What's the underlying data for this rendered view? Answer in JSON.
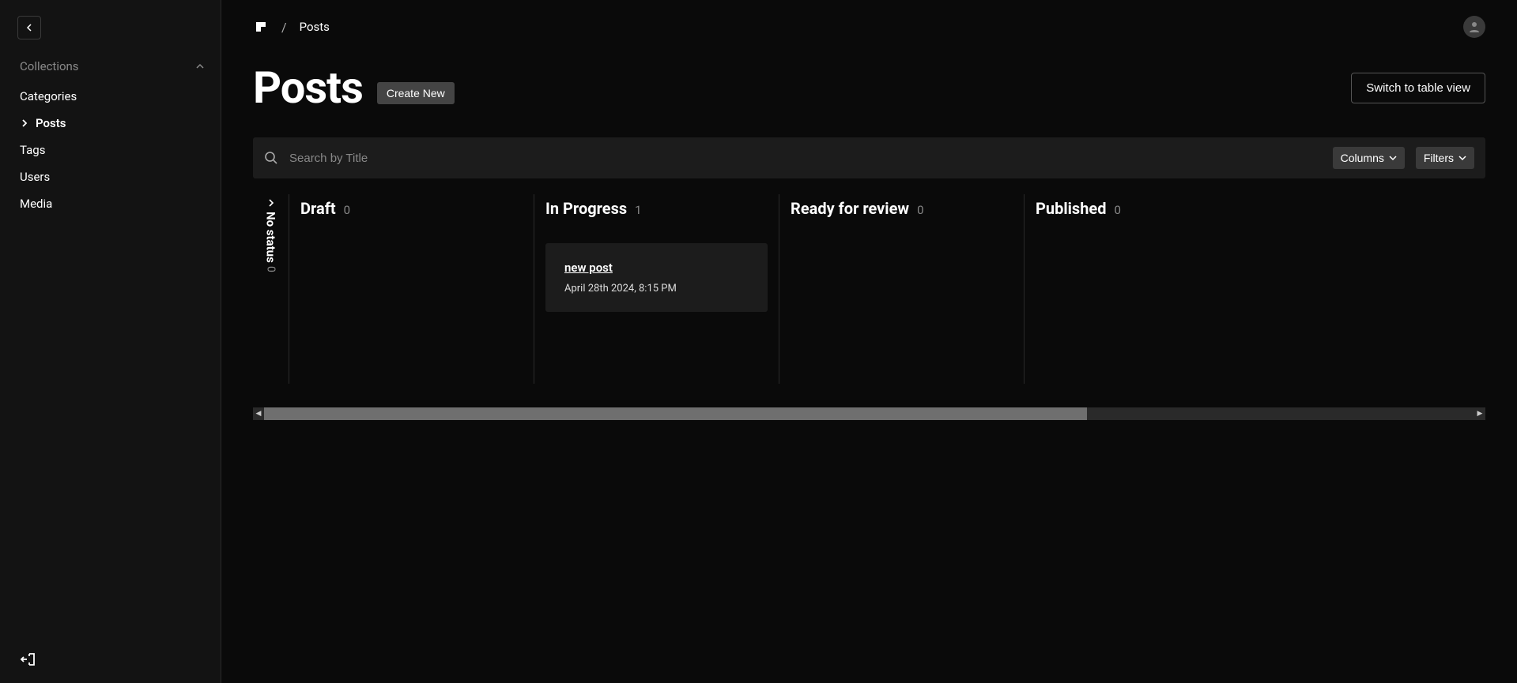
{
  "sidebar": {
    "section_label": "Collections",
    "items": [
      {
        "label": "Categories"
      },
      {
        "label": "Posts",
        "active": true
      },
      {
        "label": "Tags"
      },
      {
        "label": "Users"
      },
      {
        "label": "Media"
      }
    ]
  },
  "breadcrumb": {
    "sep": "/",
    "current": "Posts"
  },
  "header": {
    "title": "Posts",
    "create_label": "Create New",
    "switch_view_label": "Switch to table view"
  },
  "search": {
    "placeholder": "Search by Title",
    "columns_label": "Columns",
    "filters_label": "Filters"
  },
  "board": {
    "no_status": {
      "label": "No status",
      "count": "0"
    },
    "columns": [
      {
        "title": "Draft",
        "count": "0",
        "cards": []
      },
      {
        "title": "In Progress",
        "count": "1",
        "cards": [
          {
            "title": "new post",
            "subtitle": "April 28th 2024, 8:15 PM"
          }
        ]
      },
      {
        "title": "Ready for review",
        "count": "0",
        "cards": []
      },
      {
        "title": "Published",
        "count": "0",
        "cards": []
      }
    ]
  }
}
